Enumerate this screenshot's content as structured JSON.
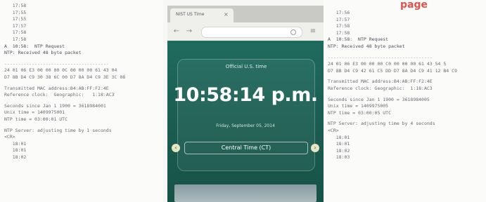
{
  "left_terminal": {
    "lines": [
      {
        "text": "   17:58",
        "kind": "normal"
      },
      {
        "text": "   17:55",
        "kind": "normal"
      },
      {
        "text": "   17:55",
        "kind": "normal"
      },
      {
        "text": "   17:57",
        "kind": "normal"
      },
      {
        "text": "   17:58",
        "kind": "normal"
      },
      {
        "text": "   17:58",
        "kind": "normal"
      },
      {
        "text": "A  10:58:  NTP Request",
        "kind": "strong"
      },
      {
        "text": "NTP: Received 48 byte packet",
        "kind": "strong"
      },
      {
        "text": "",
        "kind": "gap"
      },
      {
        "text": "--------------------------------------",
        "kind": "hr"
      },
      {
        "text": "24 01 06 E3 00 00 00 0C 00 00 00 61 43 04",
        "kind": "normal"
      },
      {
        "text": "D7 8B D4 C9 30 38 6C 00 D7 8A D4 C9 3E 3C 08",
        "kind": "normal"
      },
      {
        "text": "",
        "kind": "gap"
      },
      {
        "text": "Transmitted MAC address:B4:AB:FF:F2:4E",
        "kind": "normal"
      },
      {
        "text": "Reference clock:  Geographic:   1:18:AC3",
        "kind": "normal"
      },
      {
        "text": "",
        "kind": "gap"
      },
      {
        "text": "Seconds since Jan 1 1900 = 3618984001",
        "kind": "normal"
      },
      {
        "text": "Unix time = 1409975001",
        "kind": "normal"
      },
      {
        "text": "NTP time = 03:00:01 UTC",
        "kind": "normal"
      },
      {
        "text": "",
        "kind": "gap"
      },
      {
        "text": "NTP Server: adjusting time by 1 seconds",
        "kind": "normal"
      },
      {
        "text": "<CR>",
        "kind": "normal"
      },
      {
        "text": "   18:01",
        "kind": "normal"
      },
      {
        "text": "   18:01",
        "kind": "normal"
      },
      {
        "text": "   18:02",
        "kind": "normal"
      }
    ]
  },
  "right_terminal": {
    "lines": [
      {
        "text": "   17:56",
        "kind": "normal"
      },
      {
        "text": "   17:57",
        "kind": "normal"
      },
      {
        "text": "   17:58",
        "kind": "normal"
      },
      {
        "text": "   17:58",
        "kind": "normal"
      },
      {
        "text": "A  10:58:  NTP Request",
        "kind": "strong"
      },
      {
        "text": "NTP: Received 48 byte packet",
        "kind": "strong"
      },
      {
        "text": "",
        "kind": "gap"
      },
      {
        "text": "--------------------------------------",
        "kind": "hr"
      },
      {
        "text": "24 01 06 E3 00 00 00 C0 00 00 00 61 43 54 5",
        "kind": "normal"
      },
      {
        "text": "D7 8B D4 C9 42 61 C5 DD D7 8A D4 C9 41 12 B4 C9",
        "kind": "normal"
      },
      {
        "text": "",
        "kind": "gap"
      },
      {
        "text": "Transmitted MAC address:B4:AB:FF:F2:4E",
        "kind": "normal"
      },
      {
        "text": "Reference clock: Geographic:  1:18:AC3",
        "kind": "normal"
      },
      {
        "text": "",
        "kind": "gap"
      },
      {
        "text": "Seconds since Jan 1 1900 = 3618984005",
        "kind": "normal"
      },
      {
        "text": "Unix time = 1409975005",
        "kind": "normal"
      },
      {
        "text": "NTP time = 03:00:05 UTC",
        "kind": "normal"
      },
      {
        "text": "",
        "kind": "gap"
      },
      {
        "text": "NTP Server: adjusting time by 4 seconds",
        "kind": "normal"
      },
      {
        "text": "<CR>",
        "kind": "normal"
      },
      {
        "text": "   18:01",
        "kind": "normal"
      },
      {
        "text": "   18:01",
        "kind": "normal"
      },
      {
        "text": "   18:02",
        "kind": "normal"
      },
      {
        "text": "   18:03",
        "kind": "normal"
      }
    ]
  },
  "brand_text": "page",
  "browser": {
    "tab_title": "NIST US Time",
    "tab_close": "×",
    "back_glyph": "←",
    "forward_glyph": "→",
    "menu_glyph": "≡",
    "card_heading": "Official U.S. time",
    "clock": "10:58:14 p.m.",
    "date_line": "Friday, September 05, 2014",
    "timezone": "Central Time (CT)",
    "arrow_left": "‹",
    "arrow_right": "›"
  },
  "colors": {
    "page_bg": "#1f6b5e",
    "brand_red": "#e0524a",
    "terminal_text": "#6a6a72"
  }
}
